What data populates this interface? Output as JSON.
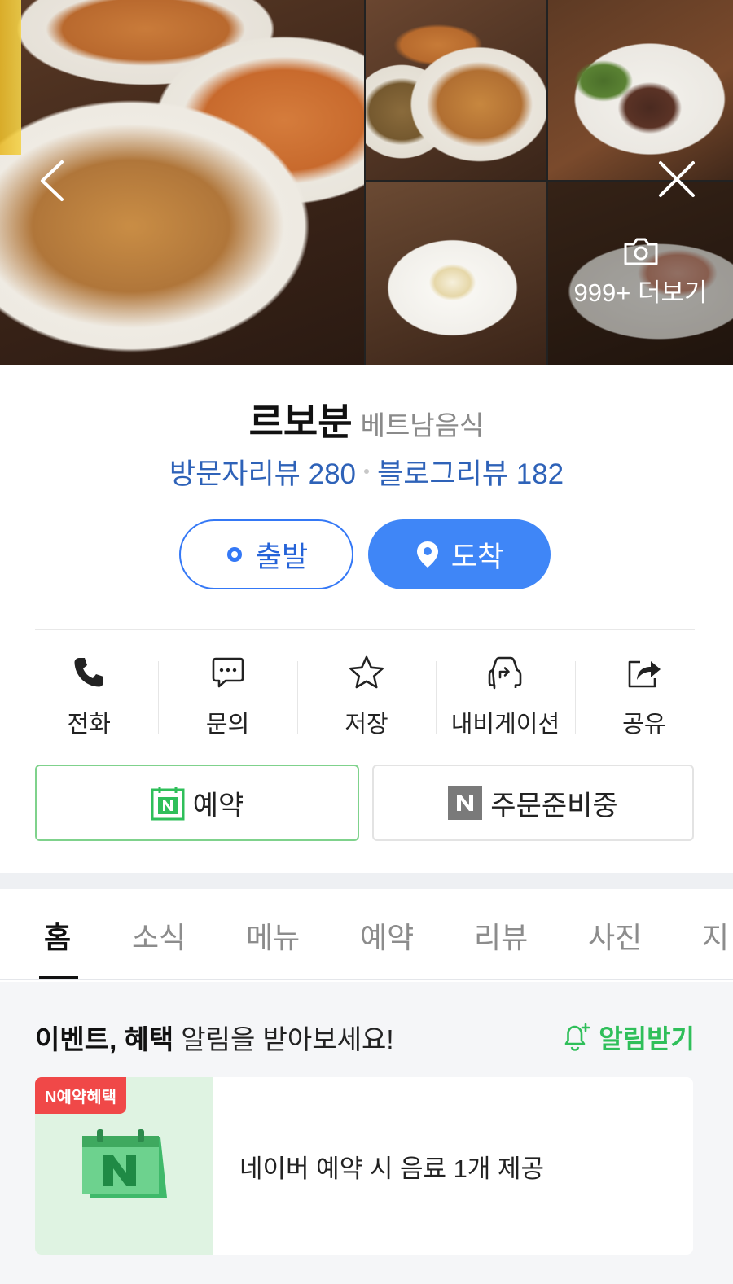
{
  "gallery": {
    "more_label": "999+ 더보기",
    "icons": {
      "back": "chevron-left-icon",
      "close": "close-icon",
      "camera": "camera-icon"
    }
  },
  "place": {
    "name": "르보분",
    "category": "베트남음식",
    "visitor_reviews": "방문자리뷰 280",
    "blog_reviews": "블로그리뷰 182"
  },
  "route": {
    "depart_label": "출발",
    "arrive_label": "도착"
  },
  "actions": [
    {
      "label": "전화",
      "icon": "phone-icon"
    },
    {
      "label": "문의",
      "icon": "chat-icon"
    },
    {
      "label": "저장",
      "icon": "star-icon"
    },
    {
      "label": "내비게이션",
      "icon": "navigation-car-icon"
    },
    {
      "label": "공유",
      "icon": "share-icon"
    }
  ],
  "booking": {
    "reserve_label": "예약",
    "order_label": "주문준비중"
  },
  "tabs": [
    "홈",
    "소식",
    "메뉴",
    "예약",
    "리뷰",
    "사진",
    "지"
  ],
  "notice": {
    "bold_text": "이벤트, 혜택",
    "rest_text": " 알림을 받아보세요!",
    "notify_label": "알림받기"
  },
  "benefit": {
    "badge": "N예약혜택",
    "text": "네이버 예약 시 음료 1개 제공"
  },
  "colors": {
    "accent_blue": "#3f86f7",
    "review_blue": "#2e62b8",
    "naver_green": "#2fbf5a",
    "badge_red": "#f04848"
  }
}
